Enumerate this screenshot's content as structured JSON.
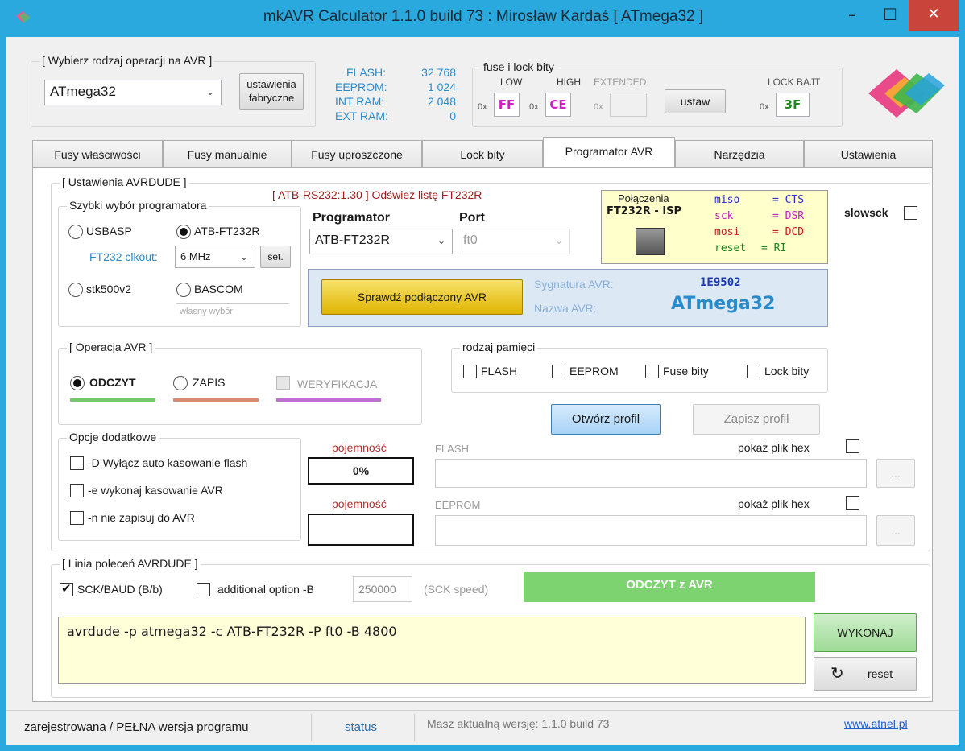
{
  "window": {
    "title": "mkAVR Calculator 1.1.0 build 73 : Mirosław Kardaś    [ ATmega32 ]",
    "min": "–",
    "max": "☐",
    "close": "✕"
  },
  "header": {
    "op_group_title": "[ Wybierz rodzaj operacji na AVR ]",
    "chip_select": "ATmega32",
    "factory_btn": "ustawienia\nfabryczne",
    "flash_label": "FLASH:",
    "flash_value": "32 768",
    "eeprom_label": "EEPROM:",
    "eeprom_value": "1 024",
    "intram_label": "INT RAM:",
    "intram_value": "2 048",
    "extram_label": "EXT RAM:",
    "extram_value": "0",
    "fuse_group_title": "fuse i lock bity",
    "low_label": "LOW",
    "high_label": "HIGH",
    "ext_label": "EXTENDED",
    "lock_label": "LOCK BAJT",
    "hex_prefix": "0x",
    "low_value": "FF",
    "high_value": "CE",
    "ext_value": "",
    "lock_value": "3F",
    "set_btn": "ustaw"
  },
  "tabs": [
    {
      "label": "Fusy właściwości"
    },
    {
      "label": "Fusy manualnie"
    },
    {
      "label": "Fusy uproszczone"
    },
    {
      "label": "Lock bity"
    },
    {
      "label": "Programator AVR"
    },
    {
      "label": "Narzędzia"
    },
    {
      "label": "Ustawienia"
    }
  ],
  "avrdude": {
    "group_title": "[ Ustawienia AVRDUDE ]",
    "device_info": "[ ATB-RS232:1.30 ]  Odśwież listę  FT232R",
    "quick_title": "Szybki wybór programatora",
    "radio_usbasp": "USBASP",
    "radio_atb": "ATB-FT232R",
    "clkout_label": "FT232 clkout:",
    "clkout_value": "6 MHz",
    "set_small": "set.",
    "radio_stk": "stk500v2",
    "radio_bascom": "BASCOM",
    "own_choice": "własny wybór",
    "programmer_label": "Programator",
    "programmer_value": "ATB-FT232R",
    "port_label": "Port",
    "port_value": "ft0",
    "conn_title1": "Połączenia",
    "conn_title2": "FT232R - ISP",
    "conn_lines": [
      {
        "pin": "miso",
        "sig": "= CTS"
      },
      {
        "pin": "sck",
        "sig": "= DSR"
      },
      {
        "pin": "mosi",
        "sig": "= DCD"
      },
      {
        "pin": "reset",
        "sig": "= RI"
      }
    ],
    "slowsck": "slowsck",
    "check_btn": "Sprawdź podłączony AVR",
    "sig_label": "Sygnatura AVR:",
    "sig_value": "1E9502",
    "name_label": "Nazwa AVR:",
    "name_value": "ATmega32"
  },
  "operation": {
    "group_title": "[ Operacja AVR ]",
    "read": "ODCZYT",
    "write": "ZAPIS",
    "verify": "WERYFIKACJA",
    "read_color": "#76c66b",
    "write_color": "#d88a73",
    "verify_color": "#c070d0"
  },
  "memory": {
    "group_title": "rodzaj pamięci",
    "flash": "FLASH",
    "eeprom": "EEPROM",
    "fuse": "Fuse bity",
    "lock": "Lock bity",
    "open_profile": "Otwórz profil",
    "save_profile": "Zapisz profil"
  },
  "extra": {
    "group_title": "Opcje dodatkowe",
    "opt_d": "-D Wyłącz auto kasowanie flash",
    "opt_e": "-e wykonaj kasowanie AVR",
    "opt_n": "-n nie zapisuj do AVR"
  },
  "files": {
    "capacity_label": "pojemność",
    "flash_capacity": "0%",
    "eeprom_capacity": "",
    "flash_label": "FLASH",
    "eeprom_label": "EEPROM",
    "show_hex": "pokaż plik hex",
    "browse": "..."
  },
  "cmdline": {
    "group_title": "[ Linia poleceń AVRDUDE ]",
    "sck_baud": "SCK/BAUD (B/b)",
    "additional": "additional option -B",
    "baud_value": "250000",
    "sck_speed": "(SCK speed)",
    "action_banner": "ODCZYT z AVR",
    "command": "avrdude -p atmega32 -c ATB-FT232R -P ft0  -B 4800",
    "execute": "WYKONAJ",
    "reset": "reset"
  },
  "statusbar": {
    "license": "zarejestrowana / PEŁNA wersja programu",
    "status": "status",
    "version": "Masz aktualną wersję: 1.1.0 build 73",
    "link": "www.atnel.pl"
  }
}
